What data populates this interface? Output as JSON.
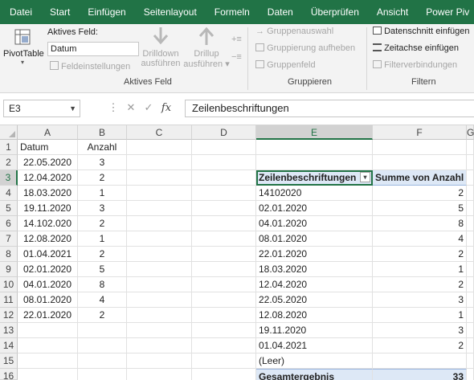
{
  "tabs": [
    "Datei",
    "Start",
    "Einfügen",
    "Seitenlayout",
    "Formeln",
    "Daten",
    "Überprüfen",
    "Ansicht",
    "Power Piv"
  ],
  "ribbon": {
    "pivottable_label": "PivotTable",
    "active_field_title": "Aktives Feld:",
    "active_field_value": "Datum",
    "field_settings": "Feldeinstellungen",
    "drilldown_line1": "Drilldown",
    "drilldown_line2": "ausführen",
    "drillup_line1": "Drillup",
    "drillup_line2": "ausführen",
    "group_active_field": "Aktives Feld",
    "group_selection": "Gruppenauswahl",
    "ungroup": "Gruppierung aufheben",
    "group_field": "Gruppenfeld",
    "group_grouping": "Gruppieren",
    "slicer": "Datenschnitt einfügen",
    "timeline": "Zeitachse einfügen",
    "filter_connections": "Filterverbindungen",
    "group_filter": "Filtern"
  },
  "formula_bar": {
    "name_box": "E3",
    "formula": "Zeilenbeschriftungen"
  },
  "columns": [
    "A",
    "B",
    "C",
    "D",
    "E",
    "F",
    "G"
  ],
  "rows": [
    "1",
    "2",
    "3",
    "4",
    "5",
    "6",
    "7",
    "8",
    "9",
    "10",
    "11",
    "12",
    "13",
    "14",
    "15",
    "16"
  ],
  "source_table": {
    "headers": [
      "Datum",
      "Anzahl"
    ],
    "records": [
      [
        "22.05.2020",
        "3"
      ],
      [
        "12.04.2020",
        "2"
      ],
      [
        "18.03.2020",
        "1"
      ],
      [
        "19.11.2020",
        "3"
      ],
      [
        "14.102.020",
        "2"
      ],
      [
        "12.08.2020",
        "1"
      ],
      [
        "01.04.2021",
        "2"
      ],
      [
        "02.01.2020",
        "5"
      ],
      [
        "04.01.2020",
        "8"
      ],
      [
        "08.01.2020",
        "4"
      ],
      [
        "22.01.2020",
        "2"
      ]
    ]
  },
  "pivot": {
    "row_header": "Zeilenbeschriftungen",
    "value_header": "Summe von Anzahl",
    "rows": [
      [
        "14102020",
        "2"
      ],
      [
        "02.01.2020",
        "5"
      ],
      [
        "04.01.2020",
        "8"
      ],
      [
        "08.01.2020",
        "4"
      ],
      [
        "22.01.2020",
        "2"
      ],
      [
        "18.03.2020",
        "1"
      ],
      [
        "12.04.2020",
        "2"
      ],
      [
        "22.05.2020",
        "3"
      ],
      [
        "12.08.2020",
        "1"
      ],
      [
        "19.11.2020",
        "3"
      ],
      [
        "01.04.2021",
        "2"
      ],
      [
        "(Leer)",
        ""
      ]
    ],
    "total_label": "Gesamtergebnis",
    "total_value": "33"
  }
}
